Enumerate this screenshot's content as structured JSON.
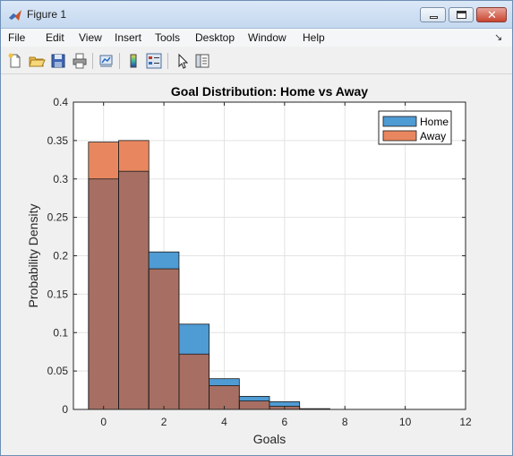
{
  "window": {
    "title": "Figure 1",
    "minimize_icon": "minimize-icon",
    "maximize_icon": "maximize-icon",
    "close_icon": "close-icon"
  },
  "menu": {
    "items": [
      "File",
      "Edit",
      "View",
      "Insert",
      "Tools",
      "Desktop",
      "Window",
      "Help"
    ]
  },
  "toolbar": {
    "icons": [
      "new-figure-icon",
      "open-file-icon",
      "save-icon",
      "print-icon",
      "link-plot-icon",
      "insert-colorbar-icon",
      "insert-legend-icon",
      "edit-plot-icon",
      "property-inspector-icon"
    ]
  },
  "chart_data": {
    "type": "bar",
    "title": "Goal Distribution: Home vs Away",
    "xlabel": "Goals",
    "ylabel": "Probability Density",
    "xlim": [
      -1,
      12
    ],
    "ylim": [
      0,
      0.4
    ],
    "xticks": [
      "0",
      "2",
      "4",
      "6",
      "8",
      "10",
      "12"
    ],
    "yticks": [
      "0",
      "0.05",
      "0.1",
      "0.15",
      "0.2",
      "0.25",
      "0.3",
      "0.35",
      "0.4"
    ],
    "bin_edges": [
      -0.5,
      0.5,
      1.5,
      2.5,
      3.5,
      4.5,
      5.5,
      6.5,
      7.5
    ],
    "grid": true,
    "legend_position": "top-right",
    "overlap_color": "#a76f63",
    "series": [
      {
        "name": "Home",
        "color": "#4f9bd4",
        "values": [
          0.3,
          0.31,
          0.205,
          0.111,
          0.04,
          0.017,
          0.01,
          0.001
        ]
      },
      {
        "name": "Away",
        "color": "#e8875f",
        "values": [
          0.348,
          0.35,
          0.183,
          0.072,
          0.031,
          0.011,
          0.004,
          0.0005
        ]
      }
    ]
  }
}
